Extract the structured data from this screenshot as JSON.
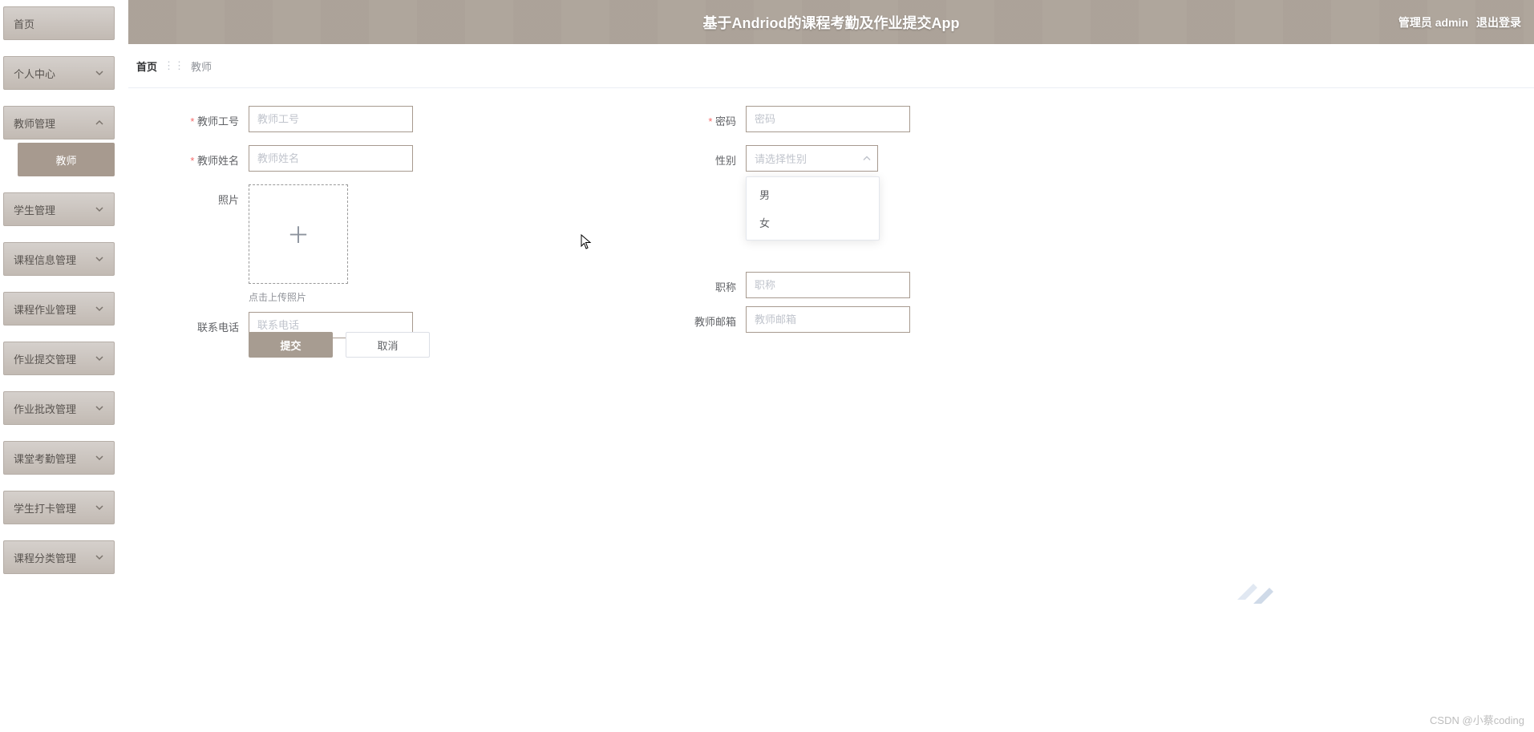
{
  "header": {
    "title": "基于Andriod的课程考勤及作业提交App",
    "admin_label": "管理员 admin",
    "logout_label": "退出登录"
  },
  "breadcrumb": {
    "home": "首页",
    "current": "教师"
  },
  "sidebar": {
    "items": [
      {
        "label": "首页",
        "expandable": false
      },
      {
        "label": "个人中心",
        "expandable": true,
        "expanded": false
      },
      {
        "label": "教师管理",
        "expandable": true,
        "expanded": true,
        "sub": "教师"
      },
      {
        "label": "学生管理",
        "expandable": true,
        "expanded": false
      },
      {
        "label": "课程信息管理",
        "expandable": true,
        "expanded": false
      },
      {
        "label": "课程作业管理",
        "expandable": true,
        "expanded": false
      },
      {
        "label": "作业提交管理",
        "expandable": true,
        "expanded": false
      },
      {
        "label": "作业批改管理",
        "expandable": true,
        "expanded": false
      },
      {
        "label": "课堂考勤管理",
        "expandable": true,
        "expanded": false
      },
      {
        "label": "学生打卡管理",
        "expandable": true,
        "expanded": false
      },
      {
        "label": "课程分类管理",
        "expandable": true,
        "expanded": false
      }
    ]
  },
  "form": {
    "teacher_id_label": "教师工号",
    "teacher_id_placeholder": "教师工号",
    "password_label": "密码",
    "password_placeholder": "密码",
    "teacher_name_label": "教师姓名",
    "teacher_name_placeholder": "教师姓名",
    "gender_label": "性别",
    "gender_placeholder": "请选择性别",
    "gender_options": [
      "男",
      "女"
    ],
    "photo_label": "照片",
    "photo_hint": "点击上传照片",
    "title_label": "职称",
    "title_placeholder": "职称",
    "phone_label": "联系电话",
    "phone_placeholder": "联系电话",
    "email_label": "教师邮箱",
    "email_placeholder": "教师邮箱",
    "submit_label": "提交",
    "cancel_label": "取消"
  },
  "watermark": "CSDN @小蔡coding"
}
